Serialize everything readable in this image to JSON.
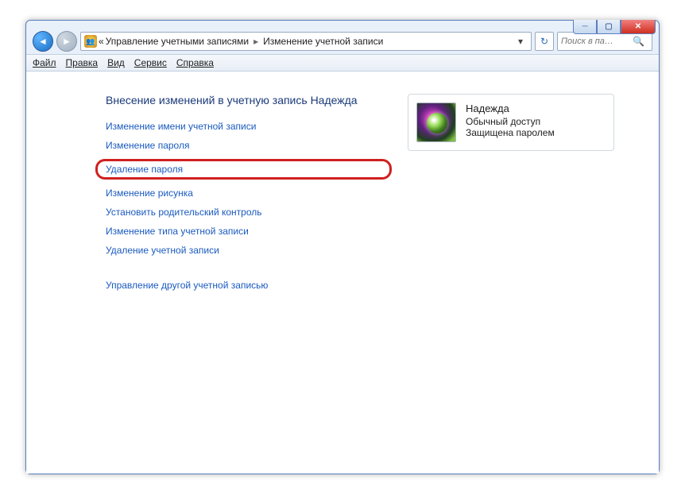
{
  "window": {
    "min": "─",
    "max": "▢",
    "close": "✕"
  },
  "nav": {
    "back": "◄",
    "fwd": "►"
  },
  "breadcrumb": {
    "prefix": "«",
    "item1": "Управление учетными записями",
    "sep": "▸",
    "item2": "Изменение учетной записи",
    "drop": "▾"
  },
  "refresh": "↻",
  "search": {
    "placeholder": "Поиск в па…",
    "icon": "🔍"
  },
  "menu": {
    "file": "Файл",
    "edit": "Правка",
    "view": "Вид",
    "tools": "Сервис",
    "help": "Справка"
  },
  "page": {
    "title": "Внесение изменений в учетную запись Надежда"
  },
  "links": {
    "rename": "Изменение имени учетной записи",
    "changepw": "Изменение пароля",
    "removepw": "Удаление пароля",
    "changepic": "Изменение рисунка",
    "parental": "Установить родительский контроль",
    "changetype": "Изменение типа учетной записи",
    "deleteacc": "Удаление учетной записи",
    "manageother": "Управление другой учетной записью"
  },
  "account": {
    "name": "Надежда",
    "type": "Обычный доступ",
    "status": "Защищена паролем"
  }
}
